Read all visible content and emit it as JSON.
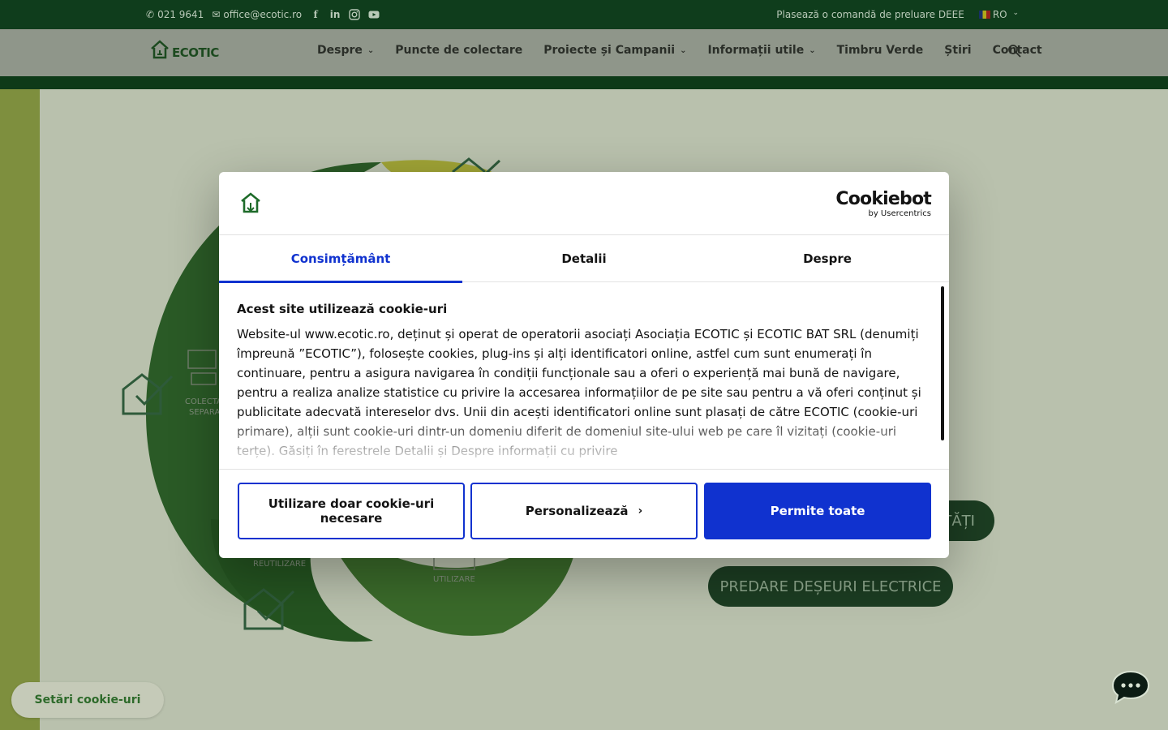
{
  "topbar": {
    "phone": "021 9641",
    "email": "office@ecotic.ro",
    "order_link": "Plasează o comandă de preluare DEEE",
    "language": "RO",
    "social": [
      "facebook-icon",
      "linkedin-icon",
      "instagram-icon",
      "youtube-icon"
    ]
  },
  "header": {
    "logo_text": "ECOTIC",
    "nav": [
      {
        "label": "Despre",
        "dropdown": true
      },
      {
        "label": "Puncte de colectare",
        "dropdown": false
      },
      {
        "label": "Proiecte și Campanii",
        "dropdown": true
      },
      {
        "label": "Informații utile",
        "dropdown": true
      },
      {
        "label": "Timbru Verde",
        "dropdown": false
      },
      {
        "label": "Știri",
        "dropdown": false
      },
      {
        "label": "Contact",
        "dropdown": false
      }
    ]
  },
  "hero": {
    "button_partial": "TĂȚI",
    "button_predare": "PREDARE DEȘEURI ELECTRICE",
    "label_colectare": "COLECTARE",
    "label_separare": "SEPARA",
    "label_reutilizare": "REUTILIZARE",
    "label_utilizare": "UTILIZARE"
  },
  "cookie_modal": {
    "brand": "Cookiebot",
    "brand_sub": "by Usercentrics",
    "tabs": [
      {
        "label": "Consimțământ",
        "active": true
      },
      {
        "label": "Detalii",
        "active": false
      },
      {
        "label": "Despre",
        "active": false
      }
    ],
    "heading": "Acest site utilizează cookie-uri",
    "text": "Website-ul www.ecotic.ro, deținut și operat de operatorii asociați Asociația ECOTIC și ECOTIC BAT SRL (denumiți împreună ”ECOTIC”),  folosește cookies, plug-ins și alți identificatori online, astfel cum sunt enumerați în continuare, pentru a asigura navigarea în condiții funcționale sau a oferi o experiență mai bună de navigare, pentru a realiza analize statistice cu privire la accesarea informațiilor de pe site sau pentru a vă oferi conținut și publicitate adecvată intereselor dvs. Unii din acești identificatori online sunt plasați de către ECOTIC (cookie-uri primare), alții sunt cookie-uri dintr-un domeniu diferit de domeniul site-ului web pe care îl vizitați (cookie-uri terțe). Găsiți în ferestrele Detalii și Despre informații cu privire",
    "btn_necessary": "Utilizare doar cookie-uri necesare",
    "btn_customize": "Personalizează",
    "btn_allow": "Permite toate",
    "accent": "#1032cf"
  },
  "floating": {
    "cookie_settings": "Setări cookie-uri"
  }
}
